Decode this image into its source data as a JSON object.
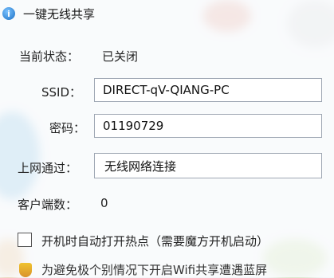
{
  "window": {
    "title": "一键无线共享"
  },
  "status": {
    "label": "当前状态：",
    "value": "已关闭"
  },
  "ssid": {
    "label": "SSID：",
    "value": "DIRECT-qV-QIANG-PC"
  },
  "password": {
    "label": "密码：",
    "value": "01190729"
  },
  "network": {
    "label": "上网通过：",
    "value": "无线网络连接"
  },
  "clients": {
    "label": "客户端数：",
    "value": "0"
  },
  "autostart": {
    "label": "开机时自动打开热点（需要魔方开机启动）",
    "checked": false
  },
  "footer": {
    "text": "为避免极个别情况下开启Wifi共享遭遇蓝屏"
  },
  "colors": {
    "accent": "#1a6fc4"
  }
}
